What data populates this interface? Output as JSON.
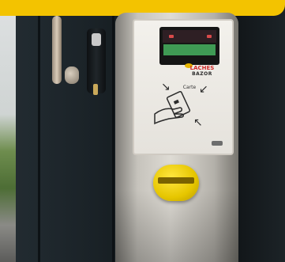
{
  "photo": {
    "lcd_text": "",
    "brand_name": "LACHES",
    "brand_sub": "BAZOR",
    "prompt_label": "Carte",
    "icons": [
      "arrow-down-right-icon",
      "arrow-down-left-icon",
      "arrow-up-left-icon",
      "card-in-hand-icon"
    ],
    "colors": {
      "banner": "#f3c300",
      "terminal_steel": "#d6d3cc",
      "coin_slot": "#f2d600",
      "lcd_green": "#3f9a54",
      "door": "#1b2328"
    }
  }
}
